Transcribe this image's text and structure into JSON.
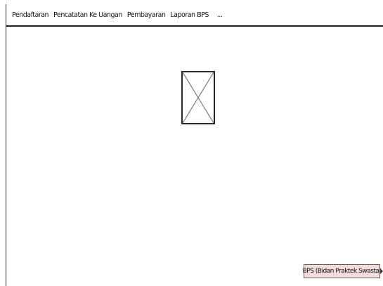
{
  "menu": {
    "items": [
      "Pendaftaran",
      "Pencatatan Ke Uangan",
      "Pembayaran",
      "Laporan BPS"
    ],
    "more_label": "..."
  },
  "main": {
    "image_placeholder_icon": "image-placeholder-icon"
  },
  "user": {
    "badge_label": "BPS (Bidan Praktek Swasta)"
  }
}
